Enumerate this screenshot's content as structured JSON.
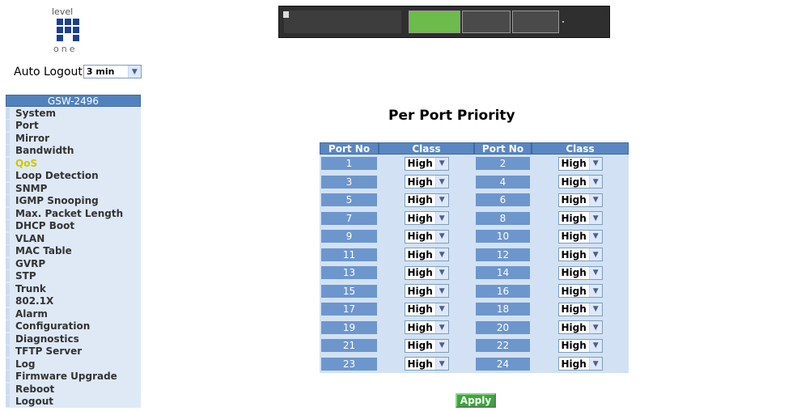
{
  "brand": {
    "top": "level",
    "bottom": "one"
  },
  "auto_logout": {
    "label": "Auto Logout",
    "value": "3 min"
  },
  "sidebar": {
    "header": "GSW-2496",
    "items": [
      "System",
      "Port",
      "Mirror",
      "Bandwidth",
      "QoS",
      "Loop Detection",
      "SNMP",
      "IGMP Snooping",
      "Max. Packet Length",
      "DHCP Boot",
      "VLAN",
      "MAC Table",
      "GVRP",
      "STP",
      "Trunk",
      "802.1X",
      "Alarm",
      "Configuration",
      "Diagnostics",
      "TFTP Server",
      "Log",
      "Firmware Upgrade",
      "Reboot",
      "Logout"
    ],
    "active": "QoS"
  },
  "page_title": "Per Port Priority",
  "table": {
    "headers": [
      "Port No",
      "Class",
      "Port No",
      "Class"
    ],
    "rows": [
      {
        "left_port": "1",
        "left_class": "High",
        "right_port": "2",
        "right_class": "High"
      },
      {
        "left_port": "3",
        "left_class": "High",
        "right_port": "4",
        "right_class": "High"
      },
      {
        "left_port": "5",
        "left_class": "High",
        "right_port": "6",
        "right_class": "High"
      },
      {
        "left_port": "7",
        "left_class": "High",
        "right_port": "8",
        "right_class": "High"
      },
      {
        "left_port": "9",
        "left_class": "High",
        "right_port": "10",
        "right_class": "High"
      },
      {
        "left_port": "11",
        "left_class": "High",
        "right_port": "12",
        "right_class": "High"
      },
      {
        "left_port": "13",
        "left_class": "High",
        "right_port": "14",
        "right_class": "High"
      },
      {
        "left_port": "15",
        "left_class": "High",
        "right_port": "16",
        "right_class": "High"
      },
      {
        "left_port": "17",
        "left_class": "High",
        "right_port": "18",
        "right_class": "High"
      },
      {
        "left_port": "19",
        "left_class": "High",
        "right_port": "20",
        "right_class": "High"
      },
      {
        "left_port": "21",
        "left_class": "High",
        "right_port": "22",
        "right_class": "High"
      },
      {
        "left_port": "23",
        "left_class": "High",
        "right_port": "24",
        "right_class": "High"
      }
    ]
  },
  "apply_label": "Apply"
}
